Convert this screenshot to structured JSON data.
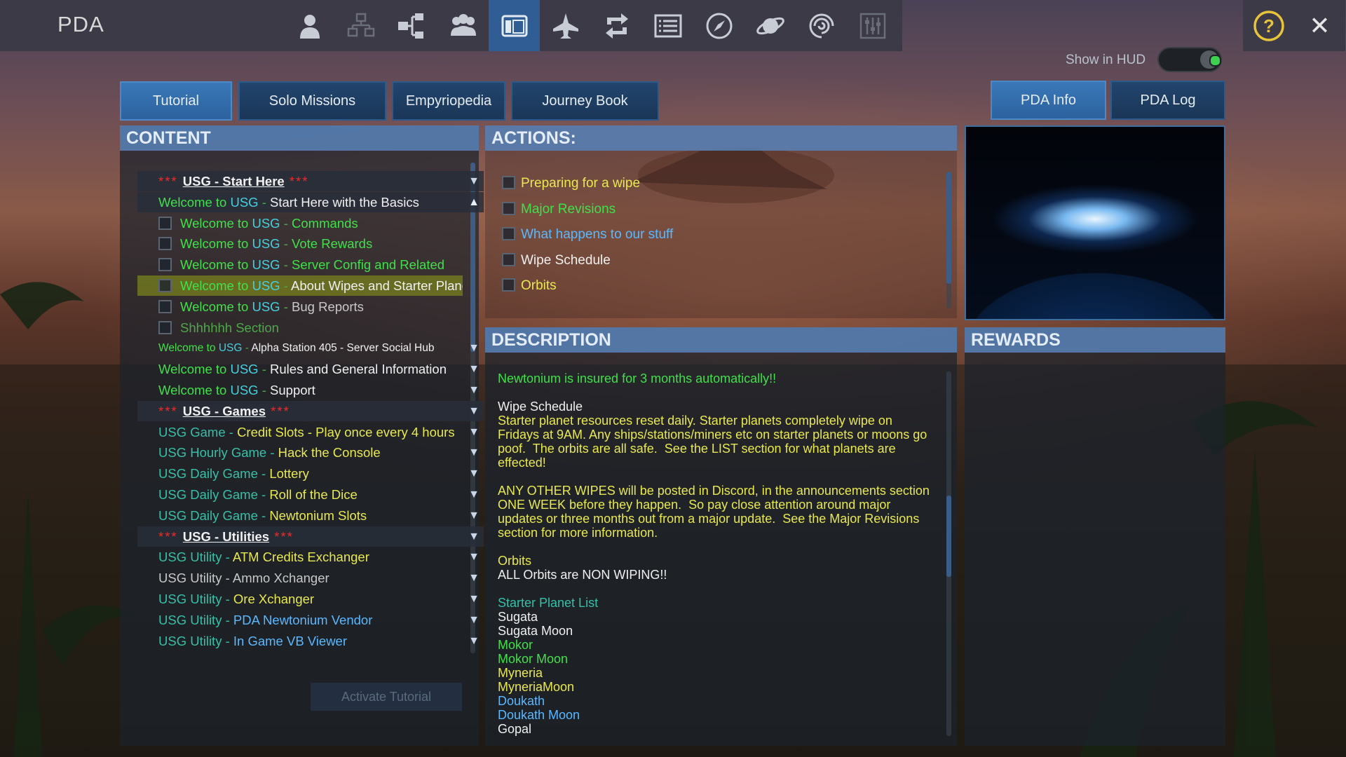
{
  "app": {
    "title": "PDA"
  },
  "toolbar": {
    "icons": [
      "player-icon",
      "structures-icon",
      "factory-icon",
      "faction-icon",
      "pda-icon",
      "ship-icon",
      "trade-icon",
      "list-icon",
      "compass-icon",
      "planet-icon",
      "galaxy-icon",
      "settings-icon"
    ],
    "active_index": 4
  },
  "corner": {
    "help": "?",
    "close": "✕"
  },
  "hud": {
    "label": "Show in HUD",
    "enabled": true
  },
  "tabs": {
    "tutorial": "Tutorial",
    "solo": "Solo Missions",
    "empyriopedia": "Empyriopedia",
    "journey": "Journey Book",
    "pda_info": "PDA Info",
    "pda_log": "PDA Log"
  },
  "content": {
    "heading": "CONTENT",
    "activate_button": "Activate Tutorial",
    "rows": [
      {
        "type": "section",
        "parts": [
          [
            "*** ",
            "red"
          ],
          [
            "USG - Start Here",
            "section"
          ],
          [
            " ***",
            "red"
          ]
        ],
        "arrow": "down"
      },
      {
        "type": "header",
        "parts": [
          [
            "Welcome to ",
            "green"
          ],
          [
            "USG",
            "cyan"
          ],
          [
            " - ",
            "dim"
          ],
          [
            "Start Here with the Basics",
            "white"
          ]
        ],
        "arrow": "up"
      },
      {
        "type": "item",
        "parts": [
          [
            "Welcome to ",
            "green"
          ],
          [
            "USG",
            "cyan"
          ],
          [
            " - ",
            "dim"
          ],
          [
            "Commands",
            "green"
          ]
        ]
      },
      {
        "type": "item",
        "parts": [
          [
            "Welcome to ",
            "green"
          ],
          [
            "USG",
            "cyan"
          ],
          [
            " - ",
            "dim"
          ],
          [
            "Vote Rewards",
            "green"
          ]
        ]
      },
      {
        "type": "item",
        "parts": [
          [
            "Welcome to ",
            "green"
          ],
          [
            "USG",
            "cyan"
          ],
          [
            " - ",
            "dim"
          ],
          [
            "Server Config and Related",
            "green"
          ]
        ]
      },
      {
        "type": "item",
        "selected": true,
        "parts": [
          [
            "Welcome to ",
            "green"
          ],
          [
            "USG",
            "cyan"
          ],
          [
            " - ",
            "dim"
          ],
          [
            "About Wipes and Starter Planets",
            "white"
          ]
        ]
      },
      {
        "type": "item",
        "parts": [
          [
            "Welcome to ",
            "green"
          ],
          [
            "USG",
            "cyan"
          ],
          [
            " - ",
            "dim"
          ],
          [
            "Bug Reports",
            "gray"
          ]
        ]
      },
      {
        "type": "item",
        "parts": [
          [
            "Shhhhhh Section",
            "dim"
          ]
        ]
      },
      {
        "type": "row",
        "small": true,
        "parts": [
          [
            "Welcome to ",
            "green"
          ],
          [
            "USG",
            "cyan"
          ],
          [
            " - ",
            "dim"
          ],
          [
            "Alpha Station 405 - Server Social Hub",
            "white"
          ]
        ],
        "arrow": "down"
      },
      {
        "type": "row",
        "parts": [
          [
            "Welcome to ",
            "green"
          ],
          [
            "USG",
            "cyan"
          ],
          [
            " - ",
            "dim"
          ],
          [
            "Rules and General Information",
            "white"
          ]
        ],
        "arrow": "down"
      },
      {
        "type": "row",
        "parts": [
          [
            "Welcome to ",
            "green"
          ],
          [
            "USG",
            "cyan"
          ],
          [
            " - ",
            "dim"
          ],
          [
            "Support",
            "white"
          ]
        ],
        "arrow": "down"
      },
      {
        "type": "section",
        "parts": [
          [
            "*** ",
            "red"
          ],
          [
            "USG - Games",
            "section"
          ],
          [
            " ***",
            "red"
          ]
        ],
        "arrow": "down"
      },
      {
        "type": "row",
        "parts": [
          [
            "USG Game - ",
            "teal"
          ],
          [
            "Credit Slots - Play once every 4 hours",
            "yellow"
          ]
        ],
        "arrow": "down"
      },
      {
        "type": "row",
        "parts": [
          [
            "USG Hourly Game - ",
            "teal"
          ],
          [
            "Hack the Console",
            "yellow"
          ]
        ],
        "arrow": "down"
      },
      {
        "type": "row",
        "parts": [
          [
            "USG Daily Game - ",
            "teal"
          ],
          [
            "Lottery",
            "yellow"
          ]
        ],
        "arrow": "down"
      },
      {
        "type": "row",
        "parts": [
          [
            "USG Daily Game - ",
            "teal"
          ],
          [
            "Roll of the Dice",
            "yellow"
          ]
        ],
        "arrow": "down"
      },
      {
        "type": "row",
        "parts": [
          [
            "USG Daily Game - ",
            "teal"
          ],
          [
            "Newtonium Slots",
            "yellow"
          ]
        ],
        "arrow": "down"
      },
      {
        "type": "section",
        "parts": [
          [
            "*** ",
            "red"
          ],
          [
            "USG - Utilities",
            "section"
          ],
          [
            " ***",
            "red"
          ]
        ],
        "arrow": "down"
      },
      {
        "type": "row",
        "parts": [
          [
            "USG Utility - ",
            "teal"
          ],
          [
            "ATM Credits Exchanger",
            "yellow"
          ]
        ],
        "arrow": "down"
      },
      {
        "type": "row",
        "parts": [
          [
            "USG Utility - Ammo Xchanger",
            "gray"
          ]
        ],
        "arrow": "down"
      },
      {
        "type": "row",
        "parts": [
          [
            "USG Utility - ",
            "teal"
          ],
          [
            "Ore Xchanger",
            "yellow"
          ]
        ],
        "arrow": "down"
      },
      {
        "type": "row",
        "parts": [
          [
            "USG Utility - ",
            "teal"
          ],
          [
            "PDA Newtonium Vendor",
            "blue"
          ]
        ],
        "arrow": "down"
      },
      {
        "type": "row",
        "parts": [
          [
            "USG Utility - ",
            "teal"
          ],
          [
            "In Game VB Viewer",
            "blue"
          ]
        ],
        "arrow": "down"
      }
    ]
  },
  "actions": {
    "heading": "ACTIONS:",
    "items": [
      {
        "label": "Preparing for a wipe",
        "color": "yellow"
      },
      {
        "label": "Major Revisions",
        "color": "green"
      },
      {
        "label": "What happens to our stuff",
        "color": "blue"
      },
      {
        "label": "Wipe Schedule",
        "color": "white"
      },
      {
        "label": "Orbits",
        "color": "yellow"
      }
    ]
  },
  "description": {
    "heading": "DESCRIPTION",
    "lines": [
      {
        "text": "Newtonium is insured for 3 months automatically!!",
        "color": "green"
      },
      {
        "text": "",
        "color": "white"
      },
      {
        "text": "Wipe Schedule",
        "color": "white"
      },
      {
        "text": "Starter planet resources reset daily. Starter planets completely wipe on Fridays at 9AM. Any ships/stations/miners etc on starter planets or moons go poof.  The orbits are all safe.  See the LIST section for what planets are effected!",
        "color": "yellow"
      },
      {
        "text": "",
        "color": "white"
      },
      {
        "text": "ANY OTHER WIPES will be posted in Discord, in the announcements section ONE WEEK before they happen.  So pay close attention around major updates or three months out from a major update.  See the Major Revisions section for more information.",
        "color": "yellow"
      },
      {
        "text": "",
        "color": "white"
      },
      {
        "text": "Orbits",
        "color": "yellow"
      },
      {
        "text": "ALL Orbits are NON WIPING!!",
        "color": "white"
      },
      {
        "text": "",
        "color": "white"
      },
      {
        "text": "Starter Planet List",
        "color": "teal"
      },
      {
        "text": "Sugata",
        "color": "white"
      },
      {
        "text": "Sugata Moon",
        "color": "white"
      },
      {
        "text": "Mokor",
        "color": "green"
      },
      {
        "text": "Mokor Moon",
        "color": "green"
      },
      {
        "text": "Myneria",
        "color": "yellow"
      },
      {
        "text": "MyneriaMoon",
        "color": "yellow"
      },
      {
        "text": "Doukath",
        "color": "blue"
      },
      {
        "text": "Doukath Moon",
        "color": "blue"
      },
      {
        "text": "Gopal",
        "color": "white"
      }
    ]
  },
  "rewards": {
    "heading": "REWARDS"
  },
  "colors": {
    "accent": "#2f5d94",
    "panel_head": "#5882b8",
    "green": "#40e04a",
    "yellow": "#e8e850",
    "blue": "#5ab8ff",
    "red": "#ee2a2a"
  }
}
